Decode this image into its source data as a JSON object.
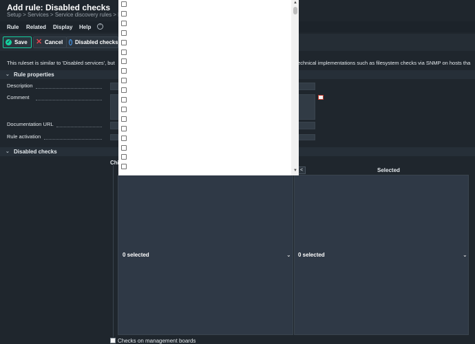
{
  "page": {
    "title": "Add rule: Disabled checks",
    "breadcrumb": "Setup > Services > Service discovery rules > Di"
  },
  "menu": {
    "items": [
      "Rule",
      "Related",
      "Display",
      "Help"
    ],
    "collapse_icon": "chevron-up-icon"
  },
  "toolbar": {
    "save_label": "Save",
    "cancel_label": "Cancel",
    "disabled_checks_label": "Disabled checks"
  },
  "info": {
    "text_left": "This ruleset is similar to 'Disabled services', but",
    "text_right": "technical implementations such as filesystem checks via SNMP on hosts tha"
  },
  "rule_properties": {
    "header": "Rule properties",
    "labels": {
      "description": "Description",
      "comment": "Comment",
      "documentation_url": "Documentation URL",
      "rule_activation": "Rule activation"
    }
  },
  "disabled_checks": {
    "header": "Disabled checks",
    "choices_label": "Chi",
    "selected_label": "Selected",
    "left_select_value": "0 selected",
    "right_select_value": "0 selected",
    "move_left_button": "<",
    "bottom_text": "Checks on management boards"
  },
  "dropdown": {
    "checkbox_count": 18,
    "scroll_up_icon": "▲",
    "scroll_down_icon": "▼"
  },
  "colors": {
    "background": "#1f262d",
    "accent_green": "#15d1a0",
    "cancel_red": "#e2434d",
    "info_blue": "#4aa3ff",
    "list_box": "#2f3946"
  }
}
